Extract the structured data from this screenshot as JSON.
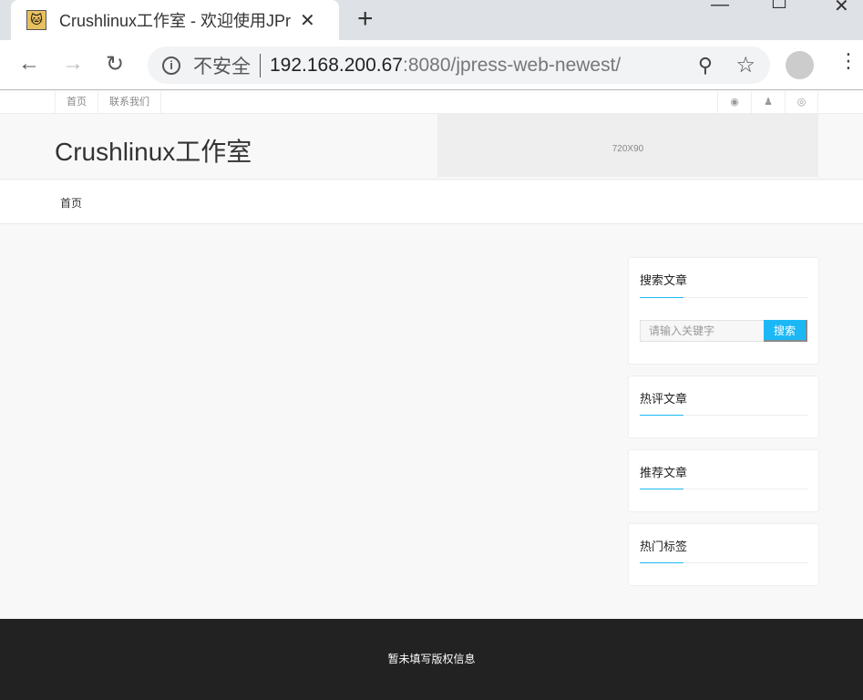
{
  "browser": {
    "tab_title": "Crushlinux工作室 - 欢迎使用JPress",
    "insecure_label": "不安全",
    "url_host": "192.168.200.67",
    "url_path": ":8080/jpress-web-newest/"
  },
  "topnav": {
    "items": [
      "首页",
      "联系我们"
    ]
  },
  "header": {
    "logo": "Crushlinux工作室",
    "ad": "720X90"
  },
  "mainnav": {
    "items": [
      "首页"
    ]
  },
  "sidebar": {
    "search_title": "搜索文章",
    "search_placeholder": "请输入关键字",
    "search_button": "搜索",
    "widgets": [
      "热评文章",
      "推荐文章",
      "热门标签"
    ]
  },
  "footer": {
    "text": "暂未填写版权信息"
  }
}
